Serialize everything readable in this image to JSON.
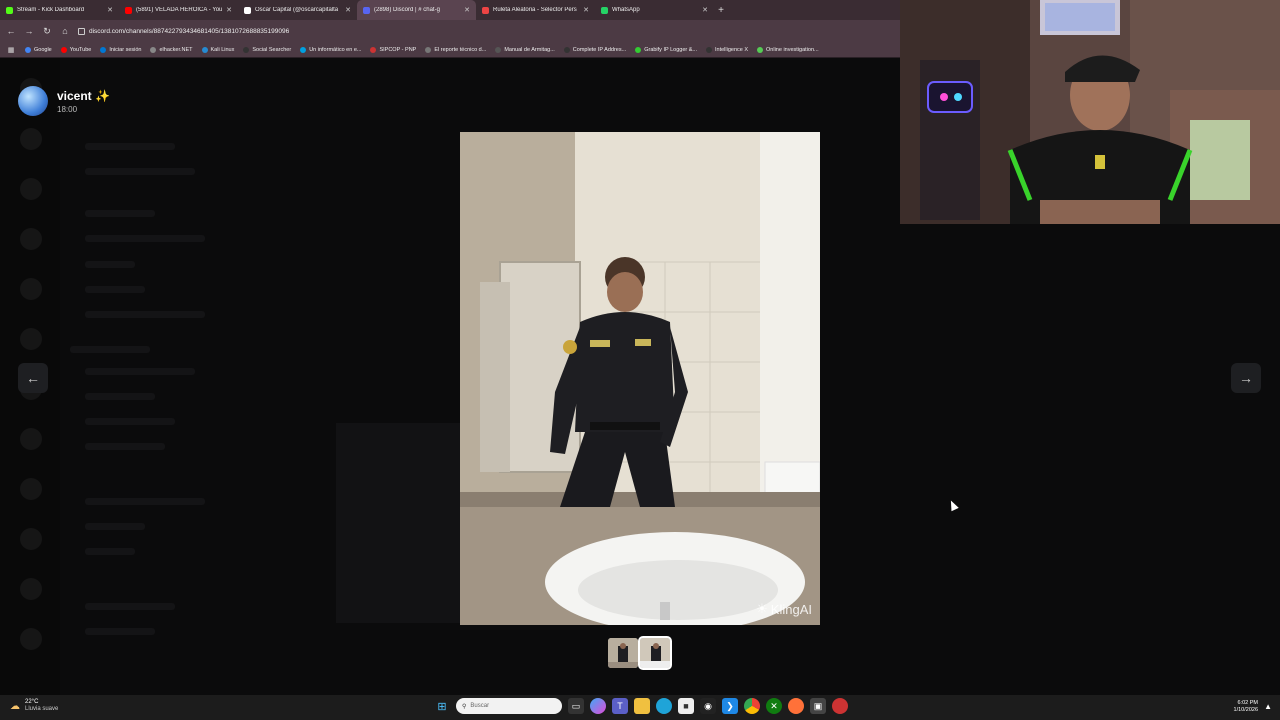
{
  "browser": {
    "tabs": [
      {
        "title": "Stream - Kick Dashboard",
        "color": "#53fc18",
        "active": false
      },
      {
        "title": "(5891) VELADA HEROICA - YouT",
        "color": "#ff0000",
        "active": false
      },
      {
        "title": "Oscar Capital (@oscarcapitalta",
        "color": "#ffffff",
        "active": false
      },
      {
        "title": "(2898) Discord | # chat-g",
        "color": "#5865f2",
        "active": true
      },
      {
        "title": "Ruleta Aleatoria - Selector Pers",
        "color": "#e44",
        "active": false
      },
      {
        "title": "WhatsApp",
        "color": "#25d366",
        "active": false
      }
    ],
    "new_tab": "+",
    "url": "discord.com/channels/887422793434681405/1381072688835199096",
    "bookmarks": [
      {
        "label": "Google",
        "color": "#4285f4"
      },
      {
        "label": "YouTube",
        "color": "#ff0000"
      },
      {
        "label": "Iniciar sesión",
        "color": "#0078d4"
      },
      {
        "label": "elhacker.NET",
        "color": "#888"
      },
      {
        "label": "Kali Linux",
        "color": "#268bd2"
      },
      {
        "label": "Social Searcher",
        "color": "#333"
      },
      {
        "label": "Un informático en e...",
        "color": "#00a0e0"
      },
      {
        "label": "SIPCOP - PNP",
        "color": "#c33"
      },
      {
        "label": "El reporte técnico d...",
        "color": "#777"
      },
      {
        "label": "Manual de Armitag...",
        "color": "#555"
      },
      {
        "label": "Complete IP Addres...",
        "color": "#333"
      },
      {
        "label": "Grabify IP Logger &...",
        "color": "#3c3"
      },
      {
        "label": "Intelligence X",
        "color": "#333"
      },
      {
        "label": "Online investigation...",
        "color": "#5c5"
      }
    ]
  },
  "viewer": {
    "author": "vicent ✨",
    "time": "18:00",
    "watermark": "KlingAI",
    "prev_icon": "arrow-left-icon",
    "next_icon": "arrow-right-icon",
    "thumbnail_count": 2
  },
  "taskbar": {
    "temperature": "22°C",
    "weather": "Lluvia suave",
    "search_placeholder": "Buscar",
    "time": "6:02 PM",
    "date": "1/10/2026"
  }
}
